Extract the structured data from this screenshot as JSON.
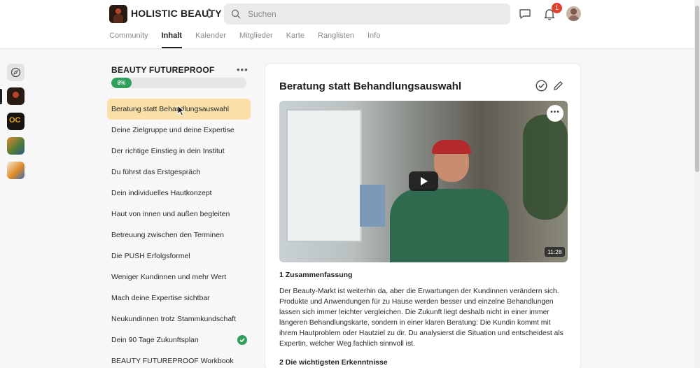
{
  "header": {
    "brand": "HOLISTIC BEAUTY",
    "search_placeholder": "Suchen",
    "notification_count": "1",
    "tabs": [
      {
        "label": "Community",
        "active": false
      },
      {
        "label": "Inhalt",
        "active": true
      },
      {
        "label": "Kalender",
        "active": false
      },
      {
        "label": "Mitglieder",
        "active": false
      },
      {
        "label": "Karte",
        "active": false
      },
      {
        "label": "Ranglisten",
        "active": false
      },
      {
        "label": "Info",
        "active": false
      }
    ]
  },
  "course": {
    "title": "BEAUTY FUTUREPROOF",
    "more": "•••",
    "progress_label": "8%",
    "progress_percent": 8,
    "lessons": [
      {
        "title": "Beratung statt Behandlungsauswahl",
        "active": true,
        "completed": false
      },
      {
        "title": "Deine Zielgruppe und deine Expertise",
        "active": false,
        "completed": false
      },
      {
        "title": "Der richtige Einstieg in dein Institut",
        "active": false,
        "completed": false
      },
      {
        "title": "Du führst das Erstgespräch",
        "active": false,
        "completed": false
      },
      {
        "title": "Dein individuelles Hautkonzept",
        "active": false,
        "completed": false
      },
      {
        "title": "Haut von innen und außen begleiten",
        "active": false,
        "completed": false
      },
      {
        "title": "Betreuung zwischen den Terminen",
        "active": false,
        "completed": false
      },
      {
        "title": "Die PUSH Erfolgsformel",
        "active": false,
        "completed": false
      },
      {
        "title": "Weniger Kundinnen und mehr Wert",
        "active": false,
        "completed": false
      },
      {
        "title": "Mach deine Expertise sichtbar",
        "active": false,
        "completed": false
      },
      {
        "title": "Neukundinnen trotz Stammkundschaft",
        "active": false,
        "completed": false
      },
      {
        "title": "Dein 90 Tage Zukunftsplan",
        "active": false,
        "completed": true
      },
      {
        "title": "BEAUTY FUTUREPROOF Workbook",
        "active": false,
        "completed": false
      }
    ]
  },
  "lesson": {
    "title": "Beratung statt Behandlungsauswahl",
    "video_more": "•••",
    "video_duration": "11:28",
    "section1_heading": "1 Zusammenfassung",
    "section1_text": "Der Beauty-Markt ist weiterhin da, aber die Erwartungen der Kundinnen verändern sich. Produkte und Anwendungen für zu Hause werden besser und einzelne Behandlungen lassen sich immer leichter vergleichen. Die Zukunft liegt deshalb nicht in einer immer längeren Behandlungskarte, sondern in einer klaren Beratung: Die Kundin kommt mit ihrem Hautproblem oder Hautziel zu dir. Du analysierst die Situation und entscheidest als Expertin, welcher Weg fachlich sinnvoll ist.",
    "section2_heading": "2 Die wichtigsten Erkenntnisse"
  },
  "icons": {
    "search": "search-icon",
    "chat": "chat-icon",
    "bell": "bell-icon",
    "explore": "compass-icon",
    "edit": "pencil-icon",
    "complete": "check-circle-icon"
  },
  "colors": {
    "accent_green": "#2ea05a",
    "active_lesson_bg": "#f8e0a8",
    "badge_red": "#e0412f"
  }
}
